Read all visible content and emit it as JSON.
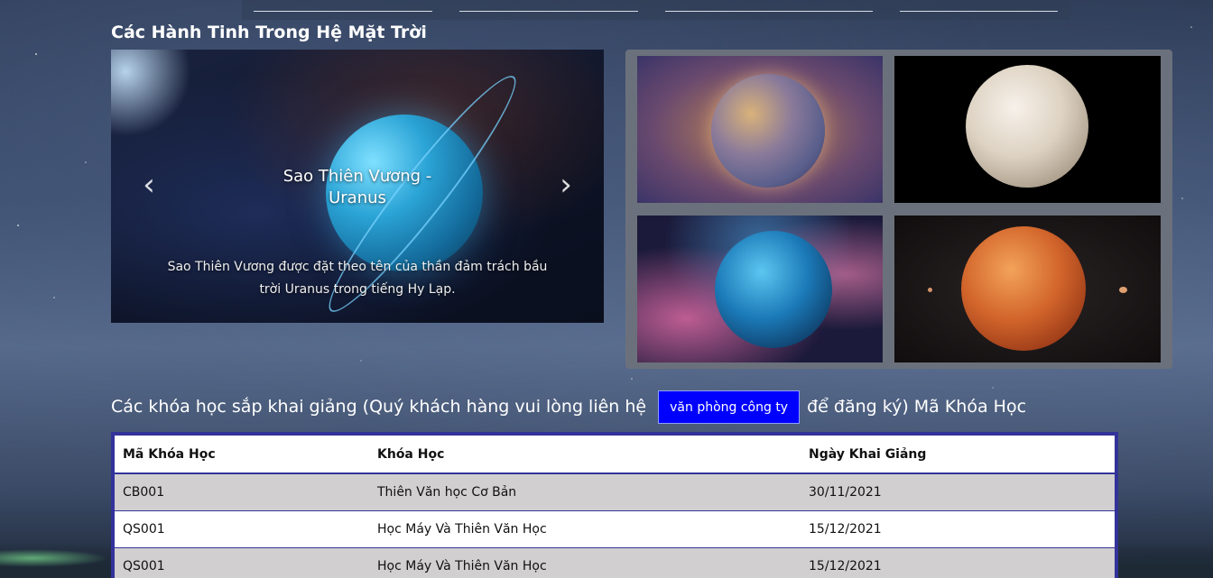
{
  "planets_section": {
    "title": "Các Hành Tinh Trong Hệ Mặt Trời",
    "carousel": {
      "slide_title": "Sao Thiên Vương - Uranus",
      "slide_caption": "Sao Thiên Vương được đặt theo tên của thần đảm trách bầu trời Uranus trong tiếng Hy Lạp.",
      "prev_icon": "chevron-left-icon",
      "next_icon": "chevron-right-icon"
    },
    "gallery": [
      "mercury-image",
      "venus-image",
      "neptune-image",
      "mars-image"
    ]
  },
  "courses_section": {
    "heading_before": "Các khóa học sắp khai giảng (Quý khách hàng vui lòng liên hệ",
    "contact_button": "văn phòng công ty",
    "heading_after": "để đăng ký) Mã Khóa Học",
    "table": {
      "headers": [
        "Mã Khóa Học",
        "Khóa Học",
        "Ngày Khai Giảng"
      ],
      "rows": [
        [
          "CB001",
          "Thiên Văn học Cơ Bản",
          "30/11/2021"
        ],
        [
          "QS001",
          "Học Máy Và Thiên Văn Học",
          "15/12/2021"
        ],
        [
          "QS001",
          "Học Máy Và Thiên Văn Học",
          "15/12/2021"
        ]
      ]
    }
  },
  "colors": {
    "button_bg": "#0000ff",
    "table_border": "#33339a",
    "row_alt": "#d1cfcf",
    "gallery_bg": "#6b717c"
  }
}
